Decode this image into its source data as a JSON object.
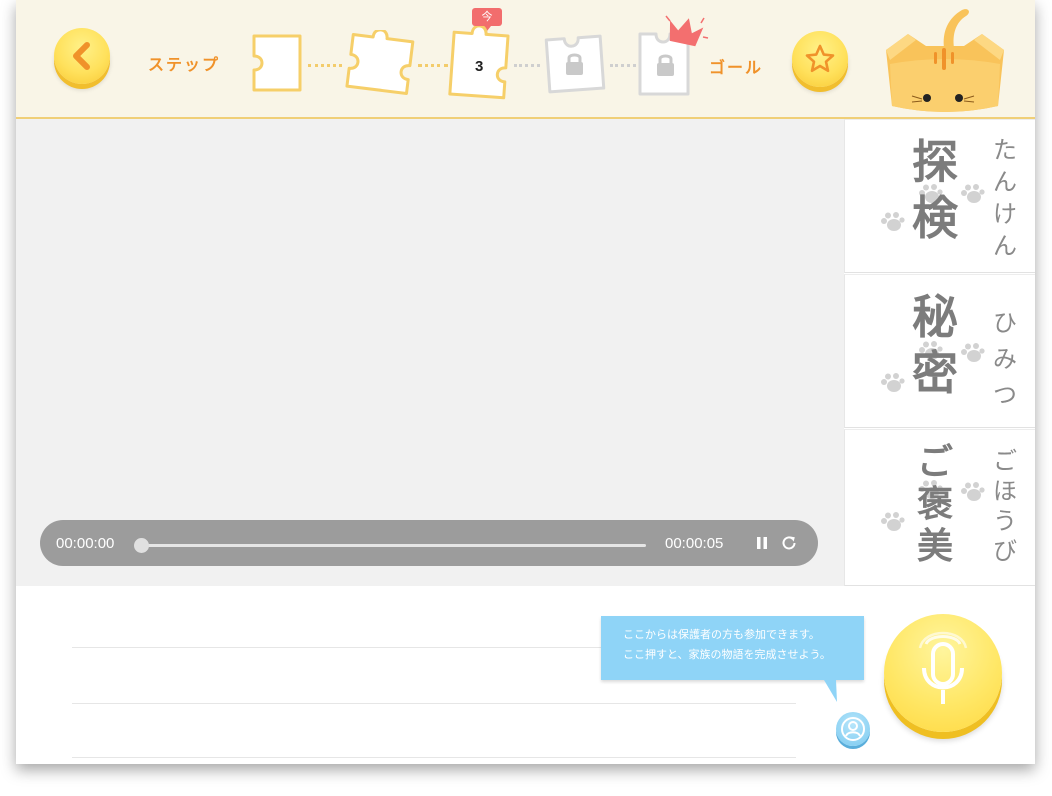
{
  "header": {
    "step_label": "ステップ",
    "goal_label": "ゴール",
    "now_badge": "今",
    "current_step": "3",
    "steps": [
      {
        "state": "done"
      },
      {
        "state": "done"
      },
      {
        "state": "current",
        "label": "3"
      },
      {
        "state": "locked"
      },
      {
        "state": "locked"
      }
    ]
  },
  "player": {
    "current_time": "00:00:00",
    "duration": "00:00:05",
    "progress": 0
  },
  "words": [
    {
      "kanji": "探検",
      "reading": "たんけん"
    },
    {
      "kanji": "秘密",
      "reading": "ひみつ"
    },
    {
      "kanji": "ご褒美",
      "reading": "ごほうび"
    }
  ],
  "tooltip": {
    "line1": "ここからは保護者の方も参加できます。",
    "line2": "ここ押すと、家族の物語を完成させよう。"
  },
  "colors": {
    "accent_orange": "#f0922a",
    "button_yellow": "#ffe15c",
    "tooltip_blue": "#8fd4f7",
    "badge_red": "#f26d6d"
  },
  "icons": [
    "chevron-left-icon",
    "star-icon",
    "lock-icon",
    "crown-icon",
    "cat-mascot",
    "pause-icon",
    "reload-icon",
    "paw-icon",
    "user-icon",
    "microphone-icon"
  ]
}
